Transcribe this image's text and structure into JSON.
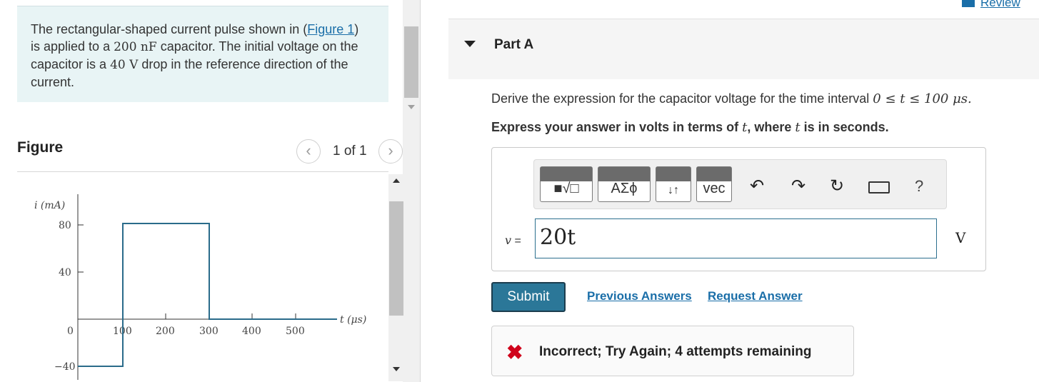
{
  "problem": {
    "text_before_link": "The rectangular-shaped current pulse shown in (",
    "link": "Figure 1",
    "text_after_link": ") is applied to a ",
    "cap_value": "200 nF",
    "text_mid": " capacitor. The initial voltage on the capacitor is a ",
    "volt_value": "40 V",
    "text_end": " drop in the reference direction of the current."
  },
  "figure": {
    "title": "Figure",
    "counter": "1 of 1",
    "prev_icon": "chevron-left-icon",
    "next_icon": "chevron-right-icon",
    "y_axis_label": "i (mA)",
    "x_axis_label": "t (μs)",
    "y_ticks": [
      "80",
      "40",
      "0",
      "−40"
    ],
    "x_ticks": [
      "100",
      "200",
      "300",
      "400",
      "500"
    ],
    "pulse_segments": [
      {
        "t_start": 0,
        "t_end": 100,
        "i": -40
      },
      {
        "t_start": 100,
        "t_end": 300,
        "i": 80
      },
      {
        "t_start": 300,
        "t_end": 500,
        "i": 0
      }
    ],
    "colors": {
      "pulse": "#2a6b8a",
      "axis": "#333333"
    }
  },
  "review": {
    "label": "Review"
  },
  "part": {
    "title": "Part A",
    "toggle_icon": "caret-down-icon"
  },
  "question": {
    "text": "Derive the expression for the capacitor voltage for the time interval ",
    "interval": "0 ≤ t ≤ 100 μs."
  },
  "instruction": {
    "pre": "Express your answer in volts in terms of ",
    "var1": "t",
    "mid": ", where ",
    "var2": "t",
    "post": " is in seconds."
  },
  "toolbar": {
    "templates_label": "■√□",
    "greek_label": "ΑΣϕ",
    "arrows_label": "↓↑",
    "vec_label": "vec",
    "help_label": "?",
    "undo_icon": "undo-icon",
    "redo_icon": "redo-icon",
    "reset_icon": "reset-icon",
    "keyboard_icon": "keyboard-icon"
  },
  "answer": {
    "var_label": "v",
    "equals": " =",
    "value": "20t",
    "unit": "V"
  },
  "actions": {
    "submit": "Submit",
    "previous_answers": "Previous Answers",
    "request_answer": "Request Answer"
  },
  "feedback": {
    "icon": "✖",
    "message": "Incorrect; Try Again; 4 attempts remaining",
    "color": "#d0021b"
  }
}
